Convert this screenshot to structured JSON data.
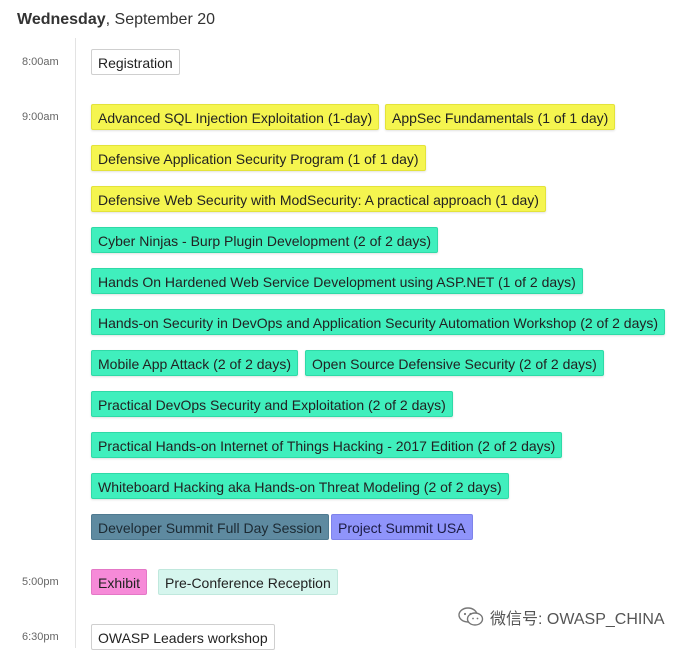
{
  "header": {
    "weekday": "Wednesday",
    "date": ", September 20"
  },
  "times": {
    "t1": "8:00am",
    "t2": "9:00am",
    "t3": "5:00pm",
    "t4": "6:30pm"
  },
  "events": {
    "registration": "Registration",
    "sql_injection": "Advanced SQL Injection Exploitation (1-day)",
    "appsec_fundamentals": "AppSec Fundamentals (1 of 1 day)",
    "defensive_program": "Defensive Application Security Program (1 of 1 day)",
    "modsecurity": "Defensive Web Security with ModSecurity: A practical approach (1 day)",
    "cyber_ninjas": "Cyber Ninjas - Burp Plugin Development (2 of 2 days)",
    "hardened_web": "Hands On Hardened Web Service Development using ASP.NET (1 of 2 days)",
    "devops_workshop": "Hands-on Security in DevOps and Application Security Automation Workshop (2 of 2 days)",
    "mobile_attack": "Mobile App Attack (2 of 2 days)",
    "open_source": "Open Source Defensive Security (2 of 2 days)",
    "devops_exploitation": "Practical DevOps Security and Exploitation (2 of 2 days)",
    "iot_hacking": "Practical Hands-on Internet of Things Hacking - 2017 Edition (2 of 2 days)",
    "whiteboard": "Whiteboard Hacking aka Hands-on Threat Modeling (2 of 2 days)",
    "dev_summit": "Developer Summit Full Day Session",
    "project_summit": "Project Summit USA",
    "exhibit": "Exhibit",
    "reception": "Pre-Conference Reception",
    "leaders_workshop": "OWASP Leaders workshop"
  },
  "colors": {
    "yellow": "#f5f54f",
    "teal": "#40efbd",
    "slate": "#5e8aa0",
    "purple": "#8f94fb",
    "pink": "#f68ad8",
    "mint": "#d6f6ee"
  },
  "watermark": {
    "icon": "wechat-icon",
    "text": "微信号: OWASP_CHINA"
  }
}
